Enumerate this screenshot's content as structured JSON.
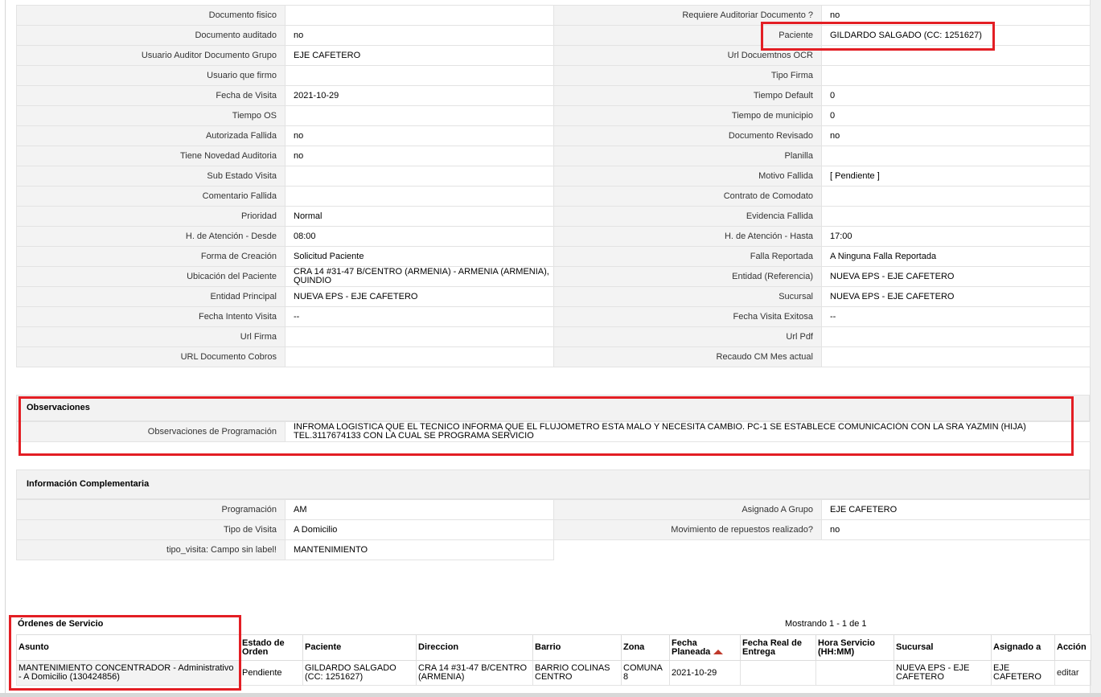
{
  "details": {
    "rows": [
      {
        "l1": "Documento fisico",
        "v1": "",
        "l2": "Requiere Auditoriar Documento ?",
        "v2": "no"
      },
      {
        "l1": "Documento auditado",
        "v1": "no",
        "l2": "Paciente",
        "v2": "GILDARDO SALGADO (CC: 1251627)"
      },
      {
        "l1": "Usuario Auditor Documento Grupo",
        "v1": "EJE CAFETERO",
        "l2": "Url Docuemtnos OCR",
        "v2": ""
      },
      {
        "l1": "Usuario que firmo",
        "v1": "",
        "l2": "Tipo Firma",
        "v2": ""
      },
      {
        "l1": "Fecha de Visita",
        "v1": "2021-10-29",
        "l2": "Tiempo Default",
        "v2": "0"
      },
      {
        "l1": "Tiempo OS",
        "v1": "",
        "l2": "Tiempo de municipio",
        "v2": "0"
      },
      {
        "l1": "Autorizada Fallida",
        "v1": "no",
        "l2": "Documento Revisado",
        "v2": "no"
      },
      {
        "l1": "Tiene Novedad Auditoria",
        "v1": "no",
        "l2": "Planilla",
        "v2": ""
      },
      {
        "l1": "Sub Estado Visita",
        "v1": "",
        "l2": "Motivo Fallida",
        "v2": "[ Pendiente ]"
      },
      {
        "l1": "Comentario Fallida",
        "v1": "",
        "l2": "Contrato de Comodato",
        "v2": ""
      },
      {
        "l1": "Prioridad",
        "v1": "Normal",
        "l2": "Evidencia Fallida",
        "v2": ""
      },
      {
        "l1": "H. de Atención - Desde",
        "v1": "08:00",
        "l2": "H. de Atención - Hasta",
        "v2": "17:00"
      },
      {
        "l1": "Forma de Creación",
        "v1": "Solicitud Paciente",
        "l2": "Falla Reportada",
        "v2": "A Ninguna Falla Reportada"
      },
      {
        "l1": "Ubicación del Paciente",
        "v1": "CRA 14 #31-47 B/CENTRO (ARMENIA) - ARMENIA (ARMENIA), QUINDIO",
        "l2": "Entidad (Referencia)",
        "v2": "NUEVA EPS - EJE CAFETERO"
      },
      {
        "l1": "Entidad Principal",
        "v1": "NUEVA EPS - EJE CAFETERO",
        "l2": "Sucursal",
        "v2": "NUEVA EPS - EJE CAFETERO"
      },
      {
        "l1": "Fecha Intento Visita",
        "v1": "--",
        "l2": "Fecha Visita Exitosa",
        "v2": "--"
      },
      {
        "l1": "Url Firma",
        "v1": "",
        "l2": "Url Pdf",
        "v2": ""
      },
      {
        "l1": "URL Documento Cobros",
        "v1": "",
        "l2": "Recaudo CM Mes actual",
        "v2": ""
      }
    ]
  },
  "observaciones": {
    "title": "Observaciones",
    "label": "Observaciones de Programación",
    "value": "INFROMA LOGISTICA QUE EL TECNICO INFORMA QUE EL FLUJOMETRO ESTA MALO Y NECESITA CAMBIO. PC-1 SE ESTABLECE COMUNICACIÓN CON LA SRA YAZMIN (HIJA) TEL.3117674133 CON LA CUAL SE PROGRAMA SERVICIO"
  },
  "complementaria": {
    "title": "Información Complementaria",
    "rows": [
      {
        "l1": "Programación",
        "v1": "AM",
        "l2": "Asignado A Grupo",
        "v2": "EJE CAFETERO"
      },
      {
        "l1": "Tipo de Visita",
        "v1": "A Domicilio",
        "l2": "Movimiento de repuestos realizado?",
        "v2": "no"
      },
      {
        "l1": "tipo_visita: Campo sin label!",
        "v1": "MANTENIMIENTO"
      }
    ]
  },
  "ordenes": {
    "title": "Órdenes de Servicio",
    "showing": "Mostrando 1 - 1 de 1",
    "headers": [
      "Asunto",
      "Estado de Orden",
      "Paciente",
      "Direccion",
      "Barrio",
      "Zona",
      "Fecha Planeada",
      "Fecha Real de Entrega",
      "Hora Servicio (HH:MM)",
      "Sucursal",
      "Asignado a",
      "Acción"
    ],
    "row": {
      "asunto": "MANTENIMIENTO CONCENTRADOR - Administrativo - A Domicilio (130424856)",
      "estado": "Pendiente",
      "paciente": "GILDARDO SALGADO (CC: 1251627)",
      "direccion": "CRA 14 #31-47 B/CENTRO (ARMENIA)",
      "barrio": "BARRIO COLINAS CENTRO",
      "zona": "COMUNA 8",
      "fecha_planeada": "2021-10-29",
      "fecha_real": "",
      "hora": "",
      "sucursal": "NUEVA EPS - EJE CAFETERO",
      "asignado": "EJE CAFETERO",
      "accion": "editar"
    }
  },
  "colors": {
    "highlight": "#e31e24",
    "label_bg": "#f3f3f3",
    "border": "#e3e3e3"
  }
}
